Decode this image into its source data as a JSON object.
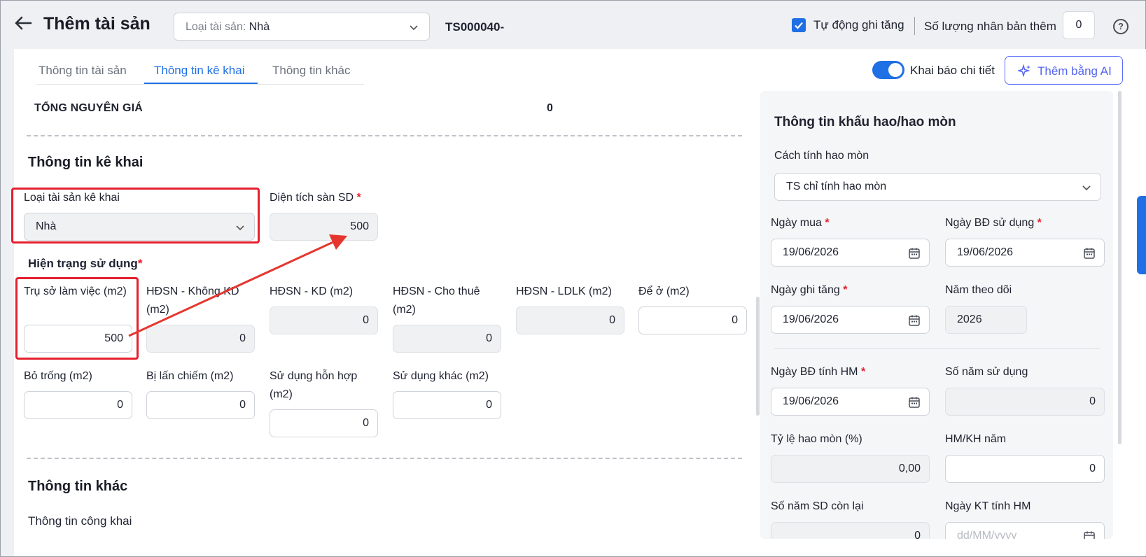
{
  "header": {
    "title": "Thêm tài sản",
    "type_select": {
      "label": "Loại tài sản:",
      "value": "Nhà"
    },
    "code": "TS000040-",
    "auto_increase": {
      "label": "Tự động ghi tăng",
      "checked": true
    },
    "copy_qty": {
      "label": "Số lượng nhân bản thêm",
      "value": "0"
    }
  },
  "tabs": [
    {
      "label": "Thông tin tài sản",
      "active": false
    },
    {
      "label": "Thông tin kê khai",
      "active": true
    },
    {
      "label": "Thông tin khác",
      "active": false
    }
  ],
  "toolbar": {
    "detail_toggle_label": "Khai báo chi tiết",
    "ai_button_label": "Thêm bằng AI"
  },
  "main": {
    "total_label": "TỔNG NGUYÊN GIÁ",
    "total_value": "0",
    "declare_heading": "Thông tin kê khai",
    "declare_type": {
      "label": "Loại tài sản kê khai",
      "value": "Nhà"
    },
    "floor_area": {
      "label": "Diện tích sàn SD",
      "value": "500"
    },
    "usage_heading": "Hiện trạng sử dụng",
    "usage_fields": [
      {
        "label": "Trụ sở làm việc (m2)",
        "value": "500"
      },
      {
        "label": "HĐSN - Không KD (m2)",
        "value": "0"
      },
      {
        "label": "HĐSN - KD (m2)",
        "value": "0"
      },
      {
        "label": "HĐSN - Cho thuê (m2)",
        "value": "0"
      },
      {
        "label": "HĐSN - LDLK (m2)",
        "value": "0"
      },
      {
        "label": "Để ở (m2)",
        "value": "0"
      },
      {
        "label": "Bỏ trống (m2)",
        "value": "0"
      },
      {
        "label": "Bị lấn chiếm (m2)",
        "value": "0"
      },
      {
        "label": "Sử dụng hỗn hợp (m2)",
        "value": "0"
      },
      {
        "label": "Sử dụng khác (m2)",
        "value": "0"
      }
    ],
    "other_heading": "Thông tin khác",
    "public_info_label": "Thông tin công khai"
  },
  "depreciation": {
    "title": "Thông tin khấu hao/hao mòn",
    "method": {
      "label": "Cách tính hao mòn",
      "value": "TS chỉ tính hao mòn"
    },
    "purchase_date": {
      "label": "Ngày mua",
      "value": "19/06/2026"
    },
    "use_start_date": {
      "label": "Ngày BĐ sử dụng",
      "value": "19/06/2026"
    },
    "increase_date": {
      "label": "Ngày ghi tăng",
      "value": "19/06/2026"
    },
    "tracking_year": {
      "label": "Năm theo dõi",
      "value": "2026"
    },
    "dep_start_date": {
      "label": "Ngày BĐ tính HM",
      "value": "19/06/2026"
    },
    "years_of_use": {
      "label": "Số năm sử dụng",
      "value": "0"
    },
    "dep_rate": {
      "label": "Tỷ lệ hao mòn (%)",
      "value": "0,00"
    },
    "annual_dep": {
      "label": "HM/KH năm",
      "value": "0"
    },
    "remaining_years": {
      "label": "Số năm SD còn lại",
      "value": "0"
    },
    "dep_end_date": {
      "label": "Ngày KT tính HM",
      "placeholder": "dd/MM/yyyy"
    }
  },
  "colors": {
    "accent": "#1f6fe5",
    "required": "#e5202e",
    "highlight": "#e5202e"
  }
}
